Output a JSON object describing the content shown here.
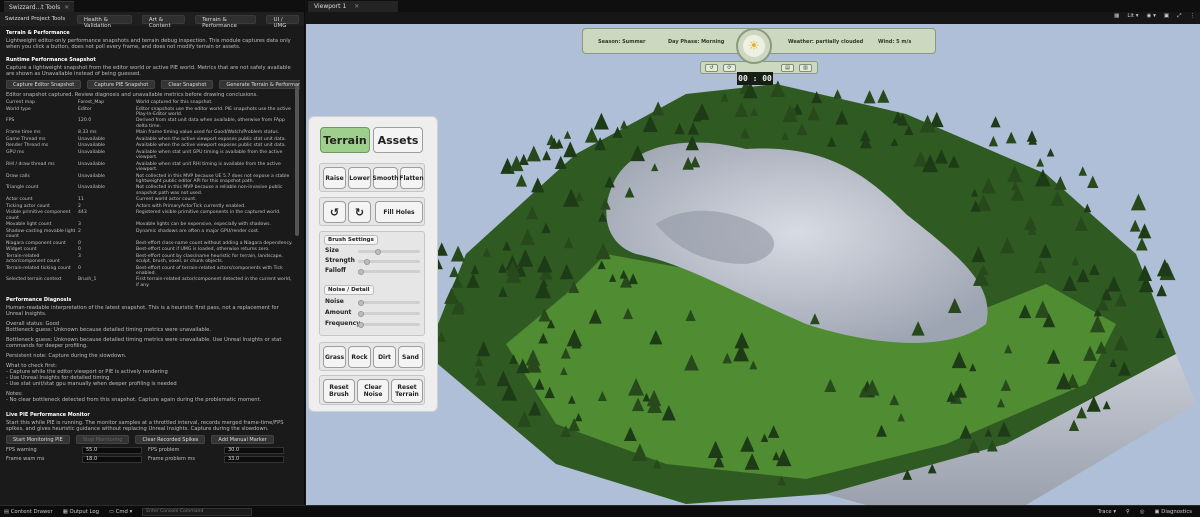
{
  "left_panel": {
    "doc_tab": "Swizzard...t Tools",
    "tool_title": "Swizzard Project Tools",
    "header_tabs": [
      "Health & Validation",
      "Art & Content",
      "Terrain & Performance",
      "UI / UMG"
    ],
    "section_title": "Terrain & Performance",
    "intro": "Lightweight editor-only performance snapshots and terrain debug inspection. This module captures data only when you click a button, does not poll every frame, and does not modify terrain or assets.",
    "snapshot_title": "Runtime Performance Snapshot",
    "snapshot_desc": "Capture a lightweight snapshot from the editor world or active PIE world. Metrics that are not safely available are shown as Unavailable instead of being guessed.",
    "snapshot_buttons": [
      "Capture Editor Snapshot",
      "Capture PIE Snapshot",
      "Clear Snapshot",
      "Generate Terrain & Performance Report"
    ],
    "snapshot_status": "Editor snapshot captured. Review diagnosis and unavailable metrics before drawing conclusions.",
    "metrics": [
      [
        "Current map",
        "Forest_Map",
        "World captured for this snapshot."
      ],
      [
        "World type",
        "Editor",
        "Editor snapshots use the editor world. PIE snapshots use the active Play-In-Editor world."
      ],
      [
        "FPS",
        "120.0",
        "Derived from stat unit data when available, otherwise from FApp delta time."
      ],
      [
        "Frame time ms",
        "8.33 ms",
        "Main frame timing value used for Good/Watch/Problem status."
      ],
      [
        "Game Thread ms",
        "Unavailable",
        "Available when the active viewport exposes public stat unit data."
      ],
      [
        "Render Thread ms",
        "Unavailable",
        "Available when the active viewport exposes public stat unit data."
      ],
      [
        "GPU ms",
        "Unavailable",
        "Available when stat unit GPU timing is available from the active viewport."
      ],
      [
        "RHI / draw thread ms",
        "Unavailable",
        "Available when stat unit RHI timing is available from the active viewport."
      ],
      [
        "Draw calls",
        "Unavailable",
        "Not collected in this MVP because UE 5.7 does not expose a stable lightweight public editor API for this snapshot path."
      ],
      [
        "Triangle count",
        "Unavailable",
        "Not collected in this MVP because a reliable non-invasive public snapshot path was not used."
      ],
      [
        "Actor count",
        "11",
        "Current world actor count."
      ],
      [
        "Ticking actor count",
        "2",
        "Actors with PrimaryActorTick currently enabled."
      ],
      [
        "Visible primitive component count",
        "443",
        "Registered visible primitive components in the captured world."
      ],
      [
        "Movable light count",
        "3",
        "Movable lights can be expensive, especially with shadows."
      ],
      [
        "Shadow-casting movable light count",
        "2",
        "Dynamic shadows are often a major GPU/render cost."
      ],
      [
        "Niagara component count",
        "0",
        "Best-effort class-name count without adding a Niagara dependency."
      ],
      [
        "Widget count",
        "0",
        "Best-effort count if UMG is loaded, otherwise returns zero."
      ],
      [
        "Terrain-related actor/component count",
        "3",
        "Best-effort count by class/name heuristic for terrain, landscape, sculpt, brush, voxel, or chunk objects."
      ],
      [
        "Terrain-related ticking count",
        "0",
        "Best-effort count of terrain-related actors/components with Tick enabled."
      ],
      [
        "Selected terrain context",
        "Brush_1",
        "First terrain-related actor/component detected in the current world, if any."
      ]
    ],
    "diagnosis_title": "Performance Diagnosis",
    "diagnosis_desc": "Human-readable interpretation of the latest snapshot. This is a heuristic first pass, not a replacement for Unreal Insights.",
    "overall_status": "Overall status: Good",
    "bottleneck_1": "Bottleneck guess: Unknown because detailed timing metrics were unavailable.",
    "bottleneck_2": "Bottleneck guess: Unknown because detailed timing metrics were unavailable. Use Unreal Insights or stat commands for deeper profiling.",
    "persistent_note": "Persistent note: Capture during the slowdown.",
    "what_check_title": "What to check first:",
    "checks": [
      "- Capture while the editor viewport or PIE is actively rendering",
      "- Use Unreal Insights for detailed timing",
      "- Use stat unit/stat gpu manually when deeper profiling is needed"
    ],
    "notes_title": "Notes:",
    "notes": "- No clear bottleneck detected from this snapshot. Capture again during the problematic moment.",
    "live_title": "Live PIE Performance Monitor",
    "live_desc": "Start this while PIE is running. The monitor samples at a throttled interval, records merged frame-time/FPS spikes, and gives heuristic guidance without replacing Unreal Insights. Capture during the slowdown.",
    "live_buttons": [
      "Start Monitoring PIE",
      "Stop Monitoring",
      "Clear Recorded Spikes",
      "Add Manual Marker"
    ],
    "thresholds": [
      {
        "label": "FPS warning",
        "value": "55.0",
        "label2": "FPS problem",
        "value2": "30.0"
      },
      {
        "label": "Frame warn ms",
        "value": "18.0",
        "label2": "Frame problem ms",
        "value2": "33.0"
      }
    ]
  },
  "viewport": {
    "tab": "Viewport 1",
    "lit_label": "Lit",
    "season": "Season: Summer",
    "day_phase": "Day Phase: Morning",
    "weather": "Weather: partially clouded",
    "wind": "Wind: 5 m/s",
    "clock": "00 : 00",
    "sun_glyph": "☀"
  },
  "terrain_panel": {
    "tabs": [
      "Terrain",
      "Assets"
    ],
    "sculpt_buttons": [
      "Raise",
      "Lower",
      "Smooth",
      "Flatten"
    ],
    "undo_glyph": "↺",
    "redo_glyph": "↻",
    "fill_holes": "Fill Holes",
    "brush_settings_title": "Brush Settings",
    "brush_sliders": [
      {
        "label": "Size",
        "value": 0.3
      },
      {
        "label": "Strength",
        "value": 0.1
      },
      {
        "label": "Falloff",
        "value": 0.0
      }
    ],
    "noise_title": "Noise / Detail",
    "noise_sliders": [
      {
        "label": "Noise",
        "value": 0.0
      },
      {
        "label": "Amount",
        "value": 0.0
      },
      {
        "label": "Frequency",
        "value": 0.0
      }
    ],
    "paint_buttons": [
      "Grass",
      "Rock",
      "Dirt",
      "Sand"
    ],
    "reset_buttons": [
      "Reset Brush",
      "Clear Noise",
      "Reset Terrain"
    ]
  },
  "status_bar": {
    "content_drawer": "Content Drawer",
    "output_log": "Output Log",
    "cmd": "Cmd",
    "console_placeholder": "Enter Console Command",
    "trace": "Trace",
    "diagnostics": "Diagnostics"
  },
  "colors": {
    "active_tab": "#9fcf8c",
    "hud_bg": "#ccd8bf",
    "sky": "#aebfd7",
    "grass": "#3f7a2e",
    "rock": "#c9cdd6"
  }
}
